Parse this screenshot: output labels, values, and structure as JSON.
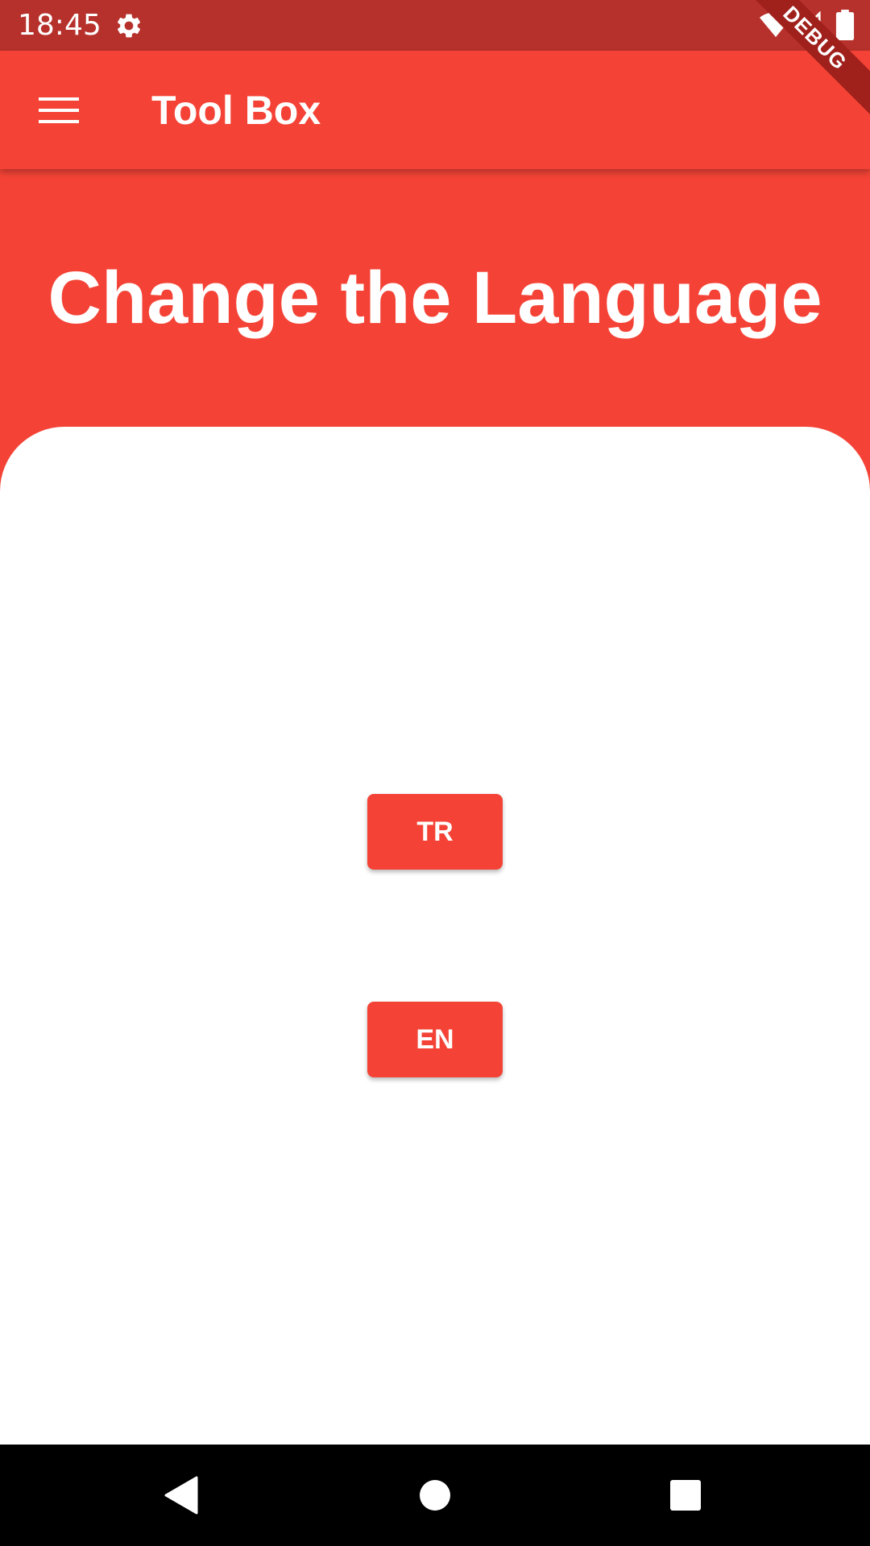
{
  "status_bar": {
    "time": "18:45",
    "icons": [
      "gear-icon",
      "wifi-icon",
      "signal-icon",
      "battery-icon"
    ]
  },
  "app_bar": {
    "title": "Tool Box",
    "menu_icon": "menu-icon"
  },
  "debug_banner": {
    "label": "DEBUG"
  },
  "header": {
    "title": "Change the Language"
  },
  "language_buttons": [
    {
      "label": "TR"
    },
    {
      "label": "EN"
    }
  ],
  "nav_bar": {
    "icons": [
      "back-icon",
      "home-icon",
      "recents-icon"
    ]
  },
  "colors": {
    "primary": "#F44336",
    "status_bar": "#B7312C",
    "card": "#FFFFFF",
    "nav_bar": "#000000"
  }
}
